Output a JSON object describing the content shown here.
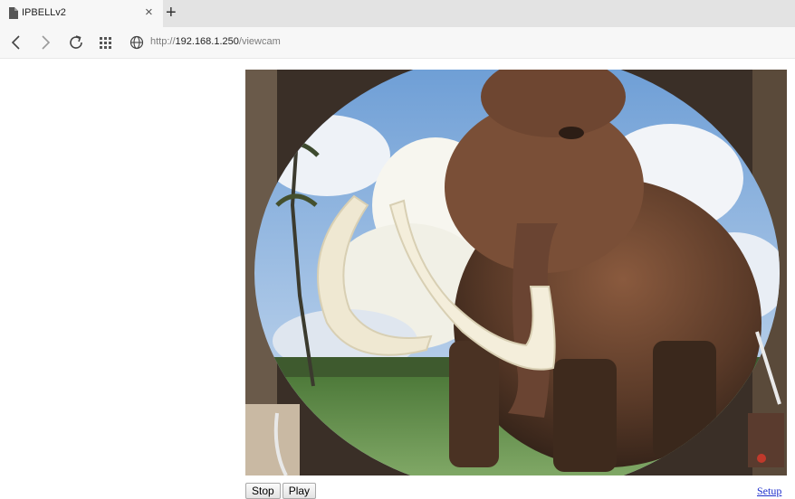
{
  "browser": {
    "tab": {
      "title": "IPBELLv2",
      "favicon": "page-icon"
    },
    "address": {
      "scheme": "http://",
      "host": "192.168.1.250",
      "path": "/viewcam"
    },
    "nav_icons": [
      "back-arrow-icon",
      "forward-arrow-icon",
      "refresh-icon",
      "apps-grid-icon",
      "globe-icon"
    ]
  },
  "page": {
    "camera_view": {
      "subject": "woolly mammoth statue in a field under blue sky (fisheye camera feed)"
    },
    "stop_label": "Stop",
    "play_label": "Play",
    "setup_label": "Setup"
  }
}
